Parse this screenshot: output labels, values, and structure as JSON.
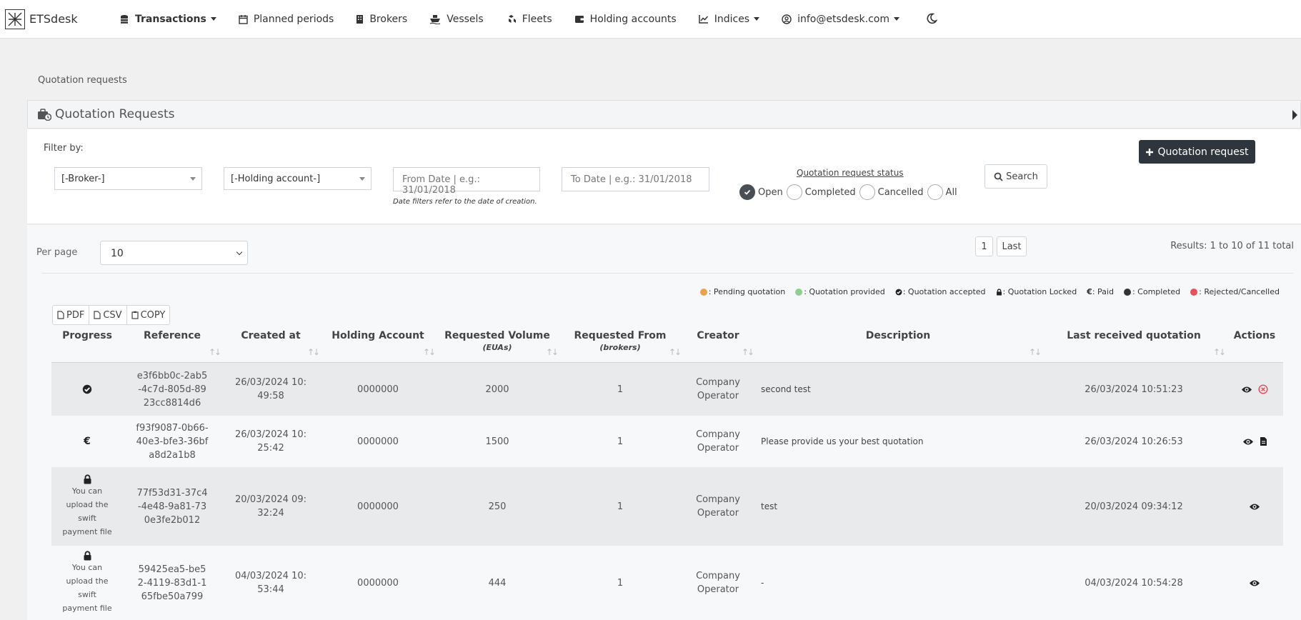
{
  "nav": {
    "brand": "ETSdesk",
    "items": [
      {
        "label": "Transactions",
        "icon": "coins-icon",
        "dropdown": true,
        "active": true
      },
      {
        "label": "Planned periods",
        "icon": "calendar-icon",
        "dropdown": false
      },
      {
        "label": "Brokers",
        "icon": "building-icon",
        "dropdown": false
      },
      {
        "label": "Vessels",
        "icon": "ship-icon",
        "dropdown": false
      },
      {
        "label": "Fleets",
        "icon": "cubes-icon",
        "dropdown": false
      },
      {
        "label": "Holding accounts",
        "icon": "wallet-icon",
        "dropdown": false
      },
      {
        "label": "Indices",
        "icon": "chart-line-icon",
        "dropdown": true
      },
      {
        "label": "info@etsdesk.com",
        "icon": "user-circle-icon",
        "dropdown": true
      }
    ],
    "theme_icon": "moon-icon"
  },
  "breadcrumb": "Quotation requests",
  "card_title": "Quotation Requests",
  "filters": {
    "label": "Filter by:",
    "broker": "[-Broker-]",
    "holding_account": "[-Holding account-]",
    "from_date_placeholder": "From Date | e.g.: 31/01/2018",
    "to_date_placeholder": "To Date | e.g.: 31/01/2018",
    "date_hint": "Date filters refer to the date of creation.",
    "status_title": "Quotation request status",
    "statuses": [
      {
        "label": "Open",
        "checked": true
      },
      {
        "label": "Completed",
        "checked": false
      },
      {
        "label": "Cancelled",
        "checked": false
      },
      {
        "label": "All",
        "checked": false
      }
    ],
    "search_label": "Search",
    "new_request_label": "Quotation request"
  },
  "list": {
    "per_page_label": "Per page",
    "per_page_value": "10",
    "pages": [
      "1",
      "Last"
    ],
    "results": "Results: 1 to 10 of 11 total",
    "legend": [
      {
        "label": ": Pending quotation",
        "color": "#f0a04b",
        "kind": "dot"
      },
      {
        "label": ": Quotation provided",
        "color": "#8fcf8f",
        "kind": "dot"
      },
      {
        "label": ": Quotation accepted",
        "color": "#222222",
        "kind": "check"
      },
      {
        "label": ": Quotation Locked",
        "color": "#222222",
        "kind": "lock"
      },
      {
        "label": ": Paid",
        "color": "#222222",
        "kind": "euro"
      },
      {
        "label": ": Completed",
        "color": "#333333",
        "kind": "dot"
      },
      {
        "label": ": Rejected/Cancelled",
        "color": "#e8505b",
        "kind": "dot"
      }
    ],
    "exports": [
      "PDF",
      "CSV",
      "COPY"
    ]
  },
  "table": {
    "columns": [
      {
        "label": "Progress",
        "sub": ""
      },
      {
        "label": "Reference",
        "sub": ""
      },
      {
        "label": "Created at",
        "sub": ""
      },
      {
        "label": "Holding Account",
        "sub": ""
      },
      {
        "label": "Requested Volume",
        "sub": "(EUAs)"
      },
      {
        "label": "Requested From",
        "sub": "(brokers)"
      },
      {
        "label": "Creator",
        "sub": ""
      },
      {
        "label": "Description",
        "sub": ""
      },
      {
        "label": "Last received quotation",
        "sub": ""
      },
      {
        "label": "Actions",
        "sub": ""
      }
    ],
    "rows": [
      {
        "progress": "check",
        "progress_text": "",
        "reference": "e3f6bb0c-2ab5-4c7d-805d-8923cc8814d6",
        "created": "26/03/2024 10:49:58",
        "holding": "0000000",
        "volume": "2000",
        "from": "1",
        "creator": "Company Operator",
        "description": "second test",
        "last_quote": "26/03/2024 10:51:23",
        "actions": [
          "eye",
          "cancel"
        ]
      },
      {
        "progress": "euro",
        "progress_text": "",
        "reference": "f93f9087-0b66-40e3-bfe3-36bfa8d2a1b8",
        "created": "26/03/2024 10:25:42",
        "holding": "0000000",
        "volume": "1500",
        "from": "1",
        "creator": "Company Operator",
        "description": "Please provide us your best quotation",
        "last_quote": "26/03/2024 10:26:53",
        "actions": [
          "eye",
          "file"
        ]
      },
      {
        "progress": "lock",
        "progress_text": "You can upload the swift payment file",
        "reference": "77f53d31-37c4-4e48-9a81-730e3fe2b012",
        "created": "20/03/2024 09:32:24",
        "holding": "0000000",
        "volume": "250",
        "from": "1",
        "creator": "Company Operator",
        "description": "test",
        "last_quote": "20/03/2024 09:34:12",
        "actions": [
          "eye"
        ]
      },
      {
        "progress": "lock",
        "progress_text": "You can upload the swift payment file",
        "reference": "59425ea5-be52-4119-83d1-165fbe50a799",
        "created": "04/03/2024 10:53:44",
        "holding": "0000000",
        "volume": "444",
        "from": "1",
        "creator": "Company Operator",
        "description": "-",
        "last_quote": "04/03/2024 10:54:28",
        "actions": [
          "eye"
        ]
      }
    ]
  }
}
